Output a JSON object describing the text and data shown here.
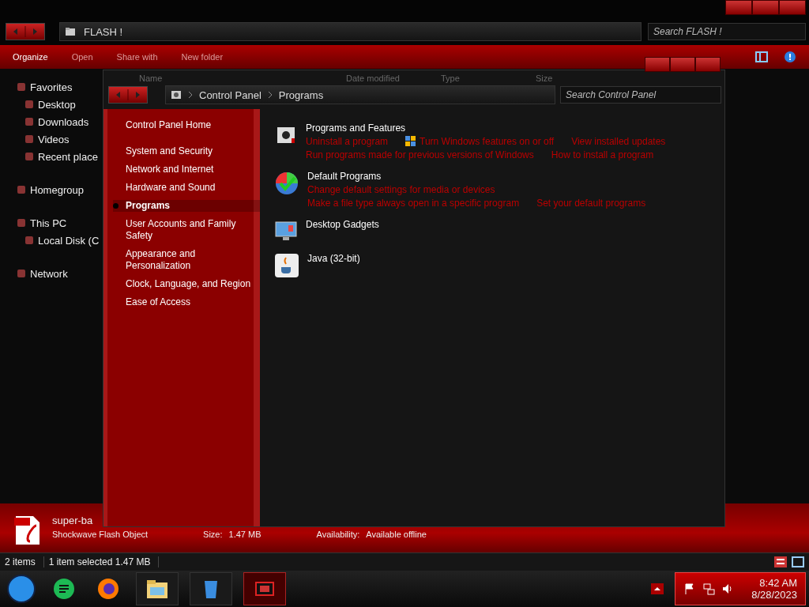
{
  "explorer": {
    "address": "FLASH !",
    "search": {
      "placeholder": "Search FLASH !"
    },
    "toolbar": [
      "Organize",
      "Open",
      "Share with",
      "New folder"
    ],
    "columns": [
      "Name",
      "Date modified",
      "Type",
      "Size"
    ],
    "nav": [
      {
        "label": "Favorites",
        "children": [
          {
            "label": "Desktop"
          },
          {
            "label": "Downloads"
          },
          {
            "label": "Videos"
          },
          {
            "label": "Recent place"
          }
        ]
      },
      {
        "label": "Homegroup"
      },
      {
        "label": "This PC",
        "children": [
          {
            "label": "Local Disk (C"
          }
        ]
      },
      {
        "label": "Network"
      }
    ],
    "details": {
      "name": "super-ba",
      "type": "Shockwave Flash Object",
      "fields": [
        {
          "label": "Size:",
          "value": "1.47 MB"
        },
        {
          "label": "Availability:",
          "value": "Available offline"
        }
      ]
    },
    "status": [
      "2 items",
      "1 item selected  1.47 MB"
    ]
  },
  "control_panel": {
    "breadcrumb": [
      "Control Panel",
      "Programs"
    ],
    "search": {
      "placeholder": "Search Control Panel"
    },
    "sidebar": [
      {
        "label": "Control Panel Home",
        "selected": false
      },
      {
        "label": "System and Security",
        "selected": false
      },
      {
        "label": "Network and Internet",
        "selected": false
      },
      {
        "label": "Hardware and Sound",
        "selected": false
      },
      {
        "label": "Programs",
        "selected": true
      },
      {
        "label": "User Accounts and Family Safety",
        "selected": false
      },
      {
        "label": "Appearance and Personalization",
        "selected": false
      },
      {
        "label": "Clock, Language, and Region",
        "selected": false
      },
      {
        "label": "Ease of Access",
        "selected": false
      }
    ],
    "categories": [
      {
        "kind": "features",
        "title": "Programs and Features",
        "links": [
          [
            "Uninstall a program",
            "Turn Windows features on or off",
            "View installed updates"
          ],
          [
            "Run programs made for previous versions of Windows",
            "How to install a program"
          ]
        ]
      },
      {
        "kind": "defaults",
        "title": "Default Programs",
        "links": [
          [
            "Change default settings for media or devices"
          ],
          [
            "Make a file type always open in a specific program",
            "Set your default programs"
          ]
        ]
      },
      {
        "kind": "gadgets",
        "title": "Desktop Gadgets"
      },
      {
        "kind": "java",
        "title": "Java (32-bit)"
      }
    ]
  },
  "taskbar": {
    "time": "8:42 AM",
    "date": "8/28/2023"
  }
}
